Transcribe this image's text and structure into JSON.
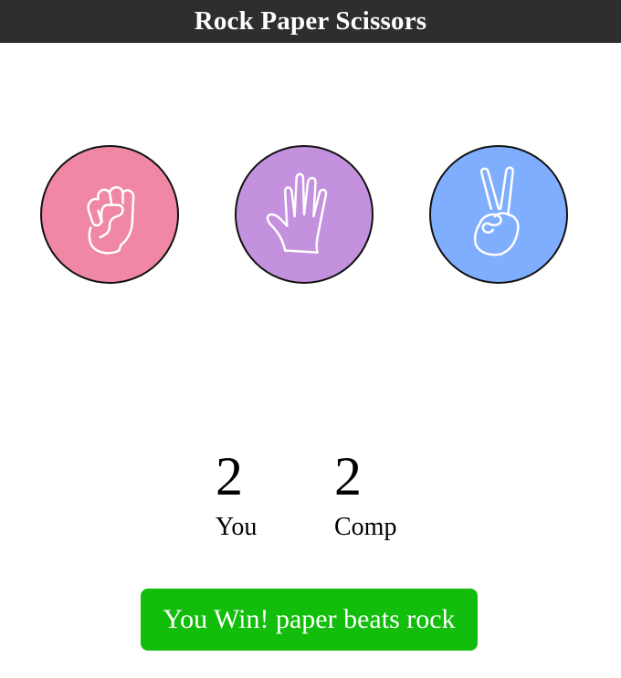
{
  "header": {
    "title": "Rock Paper Scissors"
  },
  "choices": [
    {
      "id": "rock",
      "icon": "rock-hand-icon",
      "color": "#f088a5"
    },
    {
      "id": "paper",
      "icon": "paper-hand-icon",
      "color": "#c391de"
    },
    {
      "id": "scissors",
      "icon": "scissors-hand-icon",
      "color": "#80aefe"
    }
  ],
  "scoreboard": {
    "user": {
      "value": "2",
      "label": "You"
    },
    "computer": {
      "value": "2",
      "label": "Comp"
    }
  },
  "result": {
    "message": "You Win! paper beats rock",
    "color": "#12bd0c"
  }
}
